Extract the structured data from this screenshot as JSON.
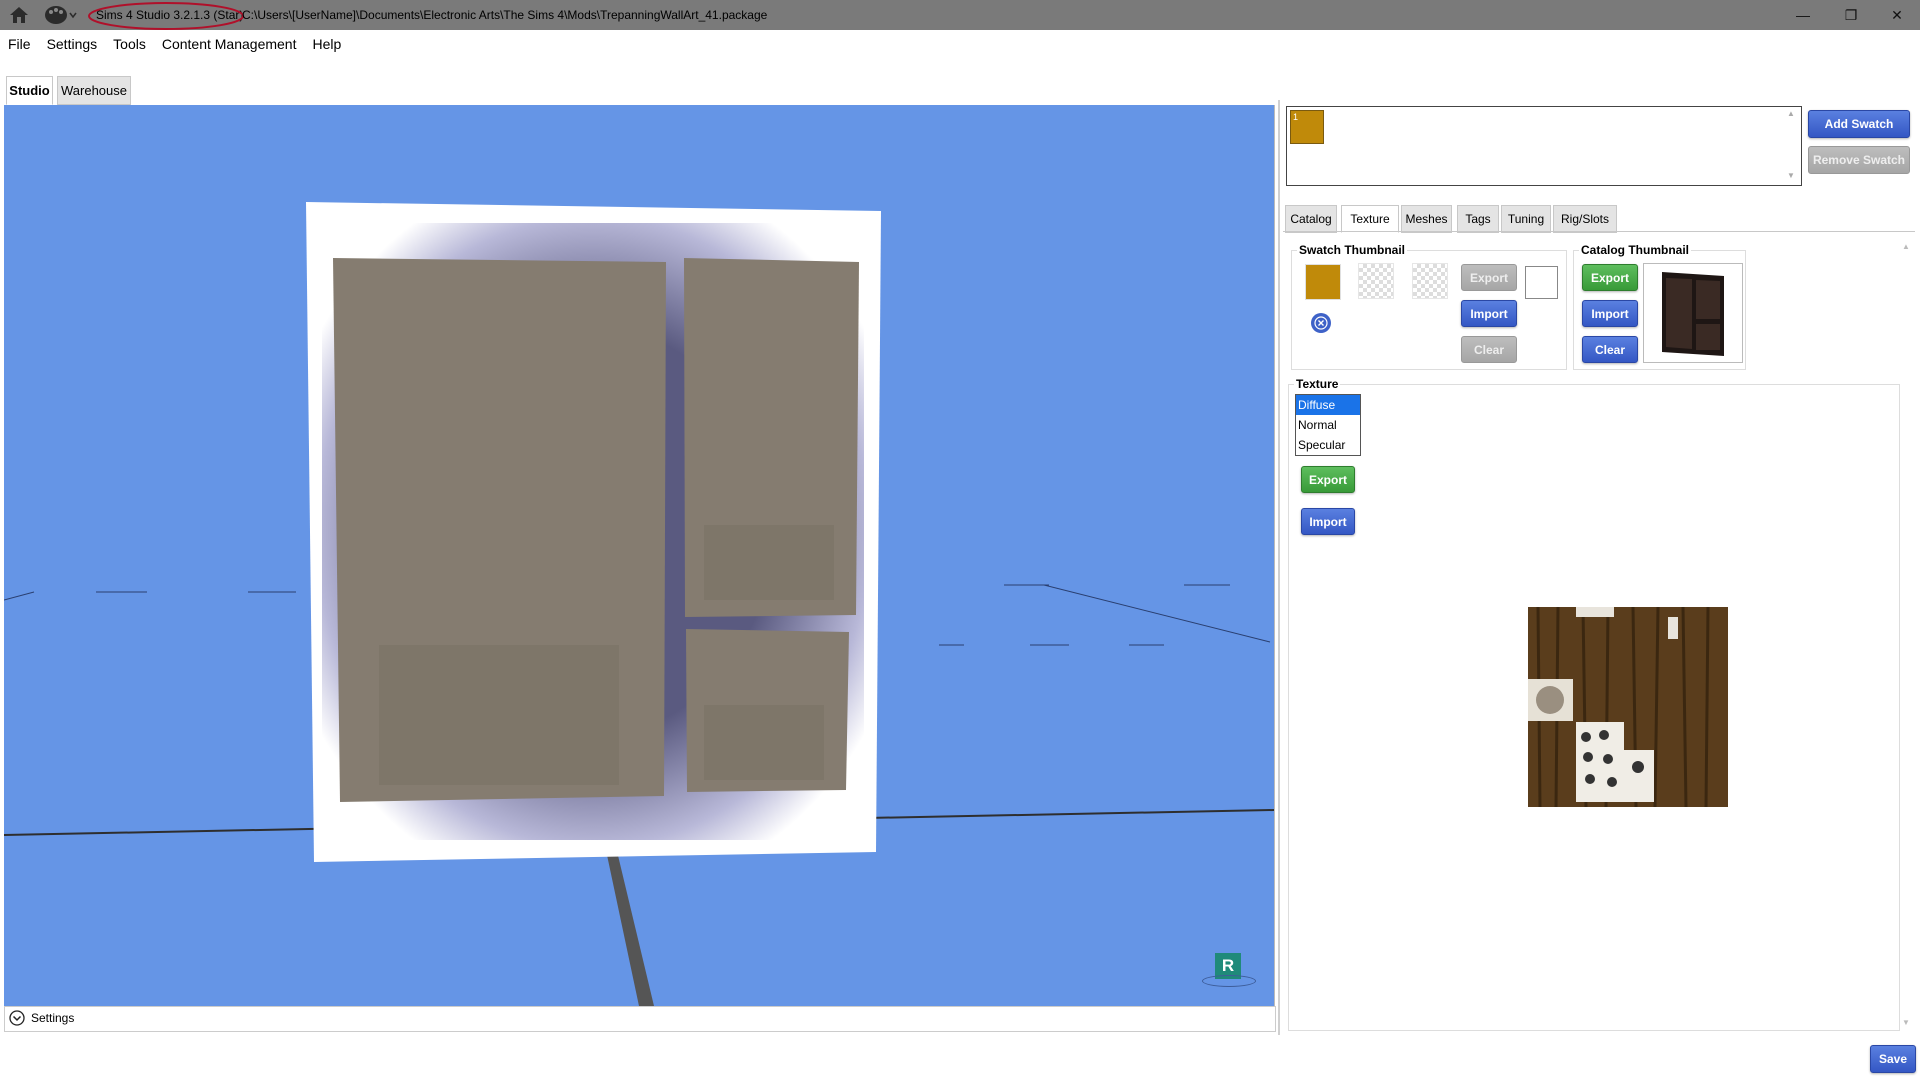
{
  "window": {
    "title": "Sims 4 Studio 3.2.1.3 (Star)",
    "path": "C:\\Users\\[UserName]\\Documents\\Electronic Arts\\The Sims 4\\Mods\\TrepanningWallArt_41.package",
    "minimize": "—",
    "restore": "❐",
    "close": "✕"
  },
  "menu": {
    "items": [
      "File",
      "Settings",
      "Tools",
      "Content Management",
      "Help"
    ]
  },
  "main_tabs": [
    "Studio",
    "Warehouse"
  ],
  "viewport": {
    "background": "#6595e6",
    "r_badge": "R",
    "settings_label": "Settings"
  },
  "swatches": {
    "swatch_color": "#c08a0a",
    "swatch_index": "1",
    "add_label": "Add Swatch",
    "remove_label": "Remove Swatch"
  },
  "right_tabs": [
    "Catalog",
    "Texture",
    "Meshes",
    "Tags",
    "Tuning",
    "Rig/Slots"
  ],
  "swatch_thumbnail": {
    "label": "Swatch Thumbnail",
    "export": "Export",
    "import": "Import",
    "clear": "Clear"
  },
  "catalog_thumbnail": {
    "label": "Catalog Thumbnail",
    "export": "Export",
    "import": "Import",
    "clear": "Clear"
  },
  "texture": {
    "label": "Texture",
    "options": [
      "Diffuse",
      "Normal",
      "Specular"
    ],
    "selected": "Diffuse",
    "export": "Export",
    "import": "Import"
  },
  "footer": {
    "save": "Save"
  }
}
